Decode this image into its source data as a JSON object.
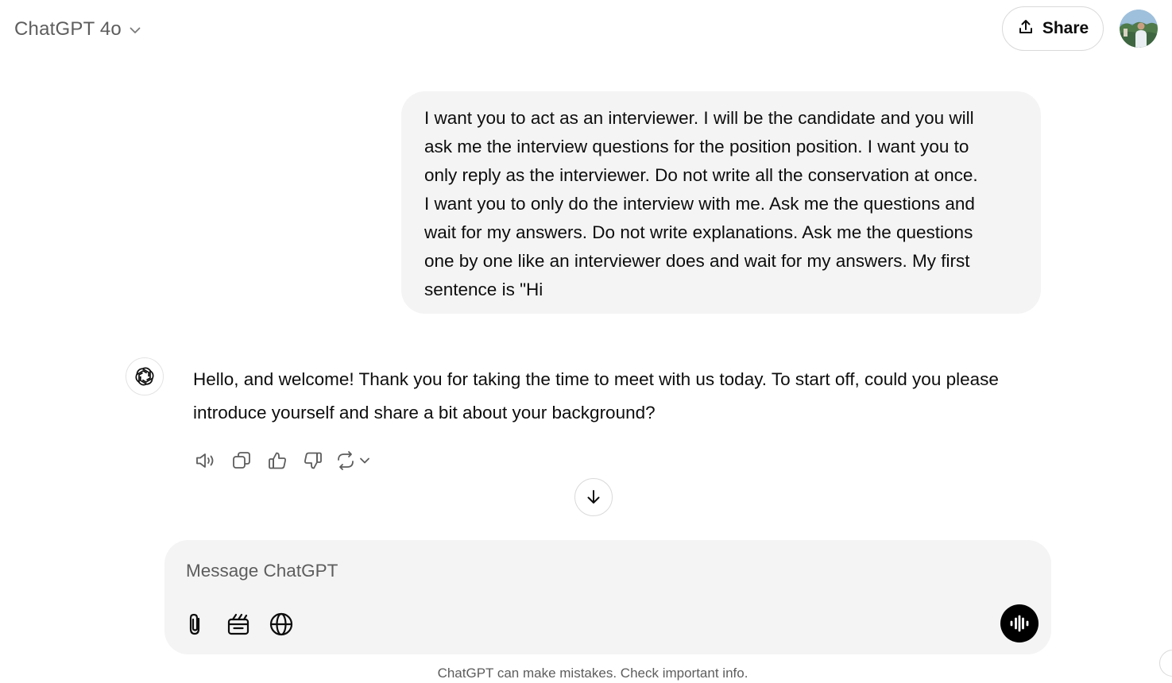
{
  "header": {
    "model_name": "ChatGPT 4o",
    "share_label": "Share"
  },
  "conversation": {
    "user_message": "I want you to act as an interviewer. I will be the candidate and you will\nask me the interview questions for the position position. I want you to\nonly reply as the interviewer. Do not write all the conservation at once.\nI want you to only do the interview with me. Ask me the questions and\nwait for my answers. Do not write explanations. Ask me the questions\none by one like an interviewer does and wait for my answers. My first\nsentence is \"Hi",
    "assistant_message": "Hello, and welcome! Thank you for taking the time to meet with us today. To start off, could you please introduce yourself and share a bit about your background?",
    "actions": [
      "read-aloud-icon",
      "copy-icon",
      "thumbs-up-icon",
      "thumbs-down-icon",
      "regenerate-icon"
    ]
  },
  "composer": {
    "placeholder": "Message ChatGPT",
    "value": "",
    "tools": [
      "attach-icon",
      "canvas-icon",
      "globe-icon"
    ],
    "voice": "voice-mode-icon"
  },
  "footer": {
    "disclaimer": "ChatGPT can make mistakes. Check important info."
  },
  "colors": {
    "bubble_bg": "#f4f4f4",
    "text": "#0d0d0d",
    "muted": "#5d5d5d",
    "border": "#d9d9d9",
    "voice_button": "#000000"
  }
}
